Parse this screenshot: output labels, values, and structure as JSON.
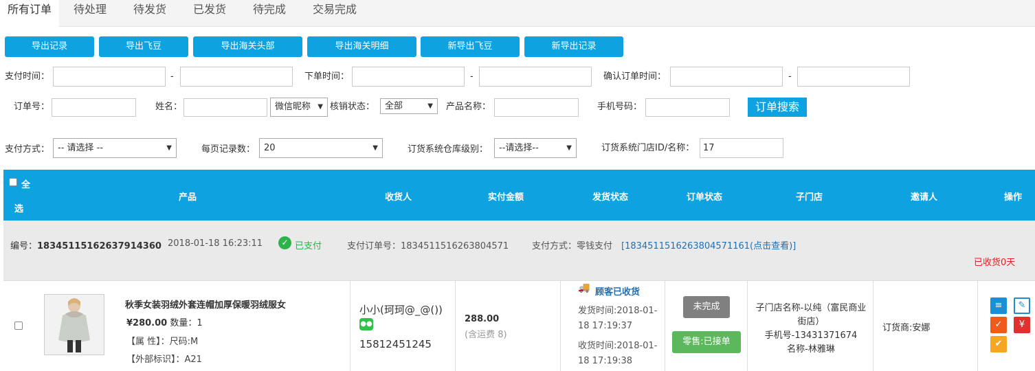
{
  "tabs": [
    "所有订单",
    "待处理",
    "待发货",
    "已发货",
    "待完成",
    "交易完成"
  ],
  "export_buttons": [
    "导出记录",
    "导出飞豆",
    "导出海关头部",
    "导出海关明细",
    "新导出飞豆",
    "新导出记录"
  ],
  "filters": {
    "pay_time_label": "支付时间：",
    "order_time_label": "下单时间：",
    "confirm_time_label": "确认订单时间：",
    "dash": "-",
    "order_no_label": "订单号：",
    "name_label": "姓名：",
    "nickname_select": "微信昵称",
    "verify_status_label": "核销状态：",
    "verify_status_value": "全部",
    "product_name_label": "产品名称：",
    "phone_label": "手机号码：",
    "search_button": "订单搜索",
    "pay_method_label": "支付方式：",
    "pay_method_value": "-- 请选择 --",
    "page_size_label": "每页记录数：",
    "page_size_value": "20",
    "warehouse_label": "订货系统仓库级别：",
    "warehouse_value": "--请选择--",
    "store_label": "订货系统门店ID/名称：",
    "store_value": "17"
  },
  "table_headers": {
    "select_all_1": "全",
    "select_all_2": "选",
    "product": "产品",
    "receiver": "收货人",
    "amount": "实付金额",
    "ship_status": "发货状态",
    "order_status": "订单状态",
    "sub_store": "子门店",
    "inviter": "邀请人",
    "actions": "操作"
  },
  "order": {
    "no_label": "编号：",
    "no_value": "18345115162637914360",
    "time": "2018-01-18 16:23:11",
    "paid": "已支付",
    "pay_order_no": "支付订单号：1834511516263804571",
    "pay_method": "支付方式：零钱支付",
    "pay_link": "[1834511516263804571161(点击查看)]",
    "received_days": "已收货0天",
    "product_title": "秋季女装羽绒外套连帽加厚保暖羽绒服女",
    "price": "¥280.00",
    "qty": "数量：1",
    "attr": "【属 性】：尺码:M",
    "ext": "【外部标识】：A21",
    "receiver_name": "小小(珂珂@_@())",
    "receiver_phone": "15812451245",
    "amount": "288.00",
    "shipping_fee": "(含运费 8)",
    "ship_status": "顾客已收货",
    "ship_time_1": "发货时间:2018-01-",
    "ship_time_2": "18 17:19:37",
    "recv_time_1": "收货时间:2018-01-",
    "recv_time_2": "18 17:19:38",
    "status_unfinished": "未完成",
    "status_retail": "零售:已接单",
    "store_1": "子门店名称-以纯（富民商业",
    "store_2": "街店）",
    "store_3": "手机号-13431371674",
    "store_4": "名称-林雅琳",
    "inviter": "订货商:安娜"
  },
  "colors": {
    "accent": "#0ea2e0",
    "paid": "#2fb24a",
    "link": "#1f6fb5",
    "red": "#e02020"
  }
}
